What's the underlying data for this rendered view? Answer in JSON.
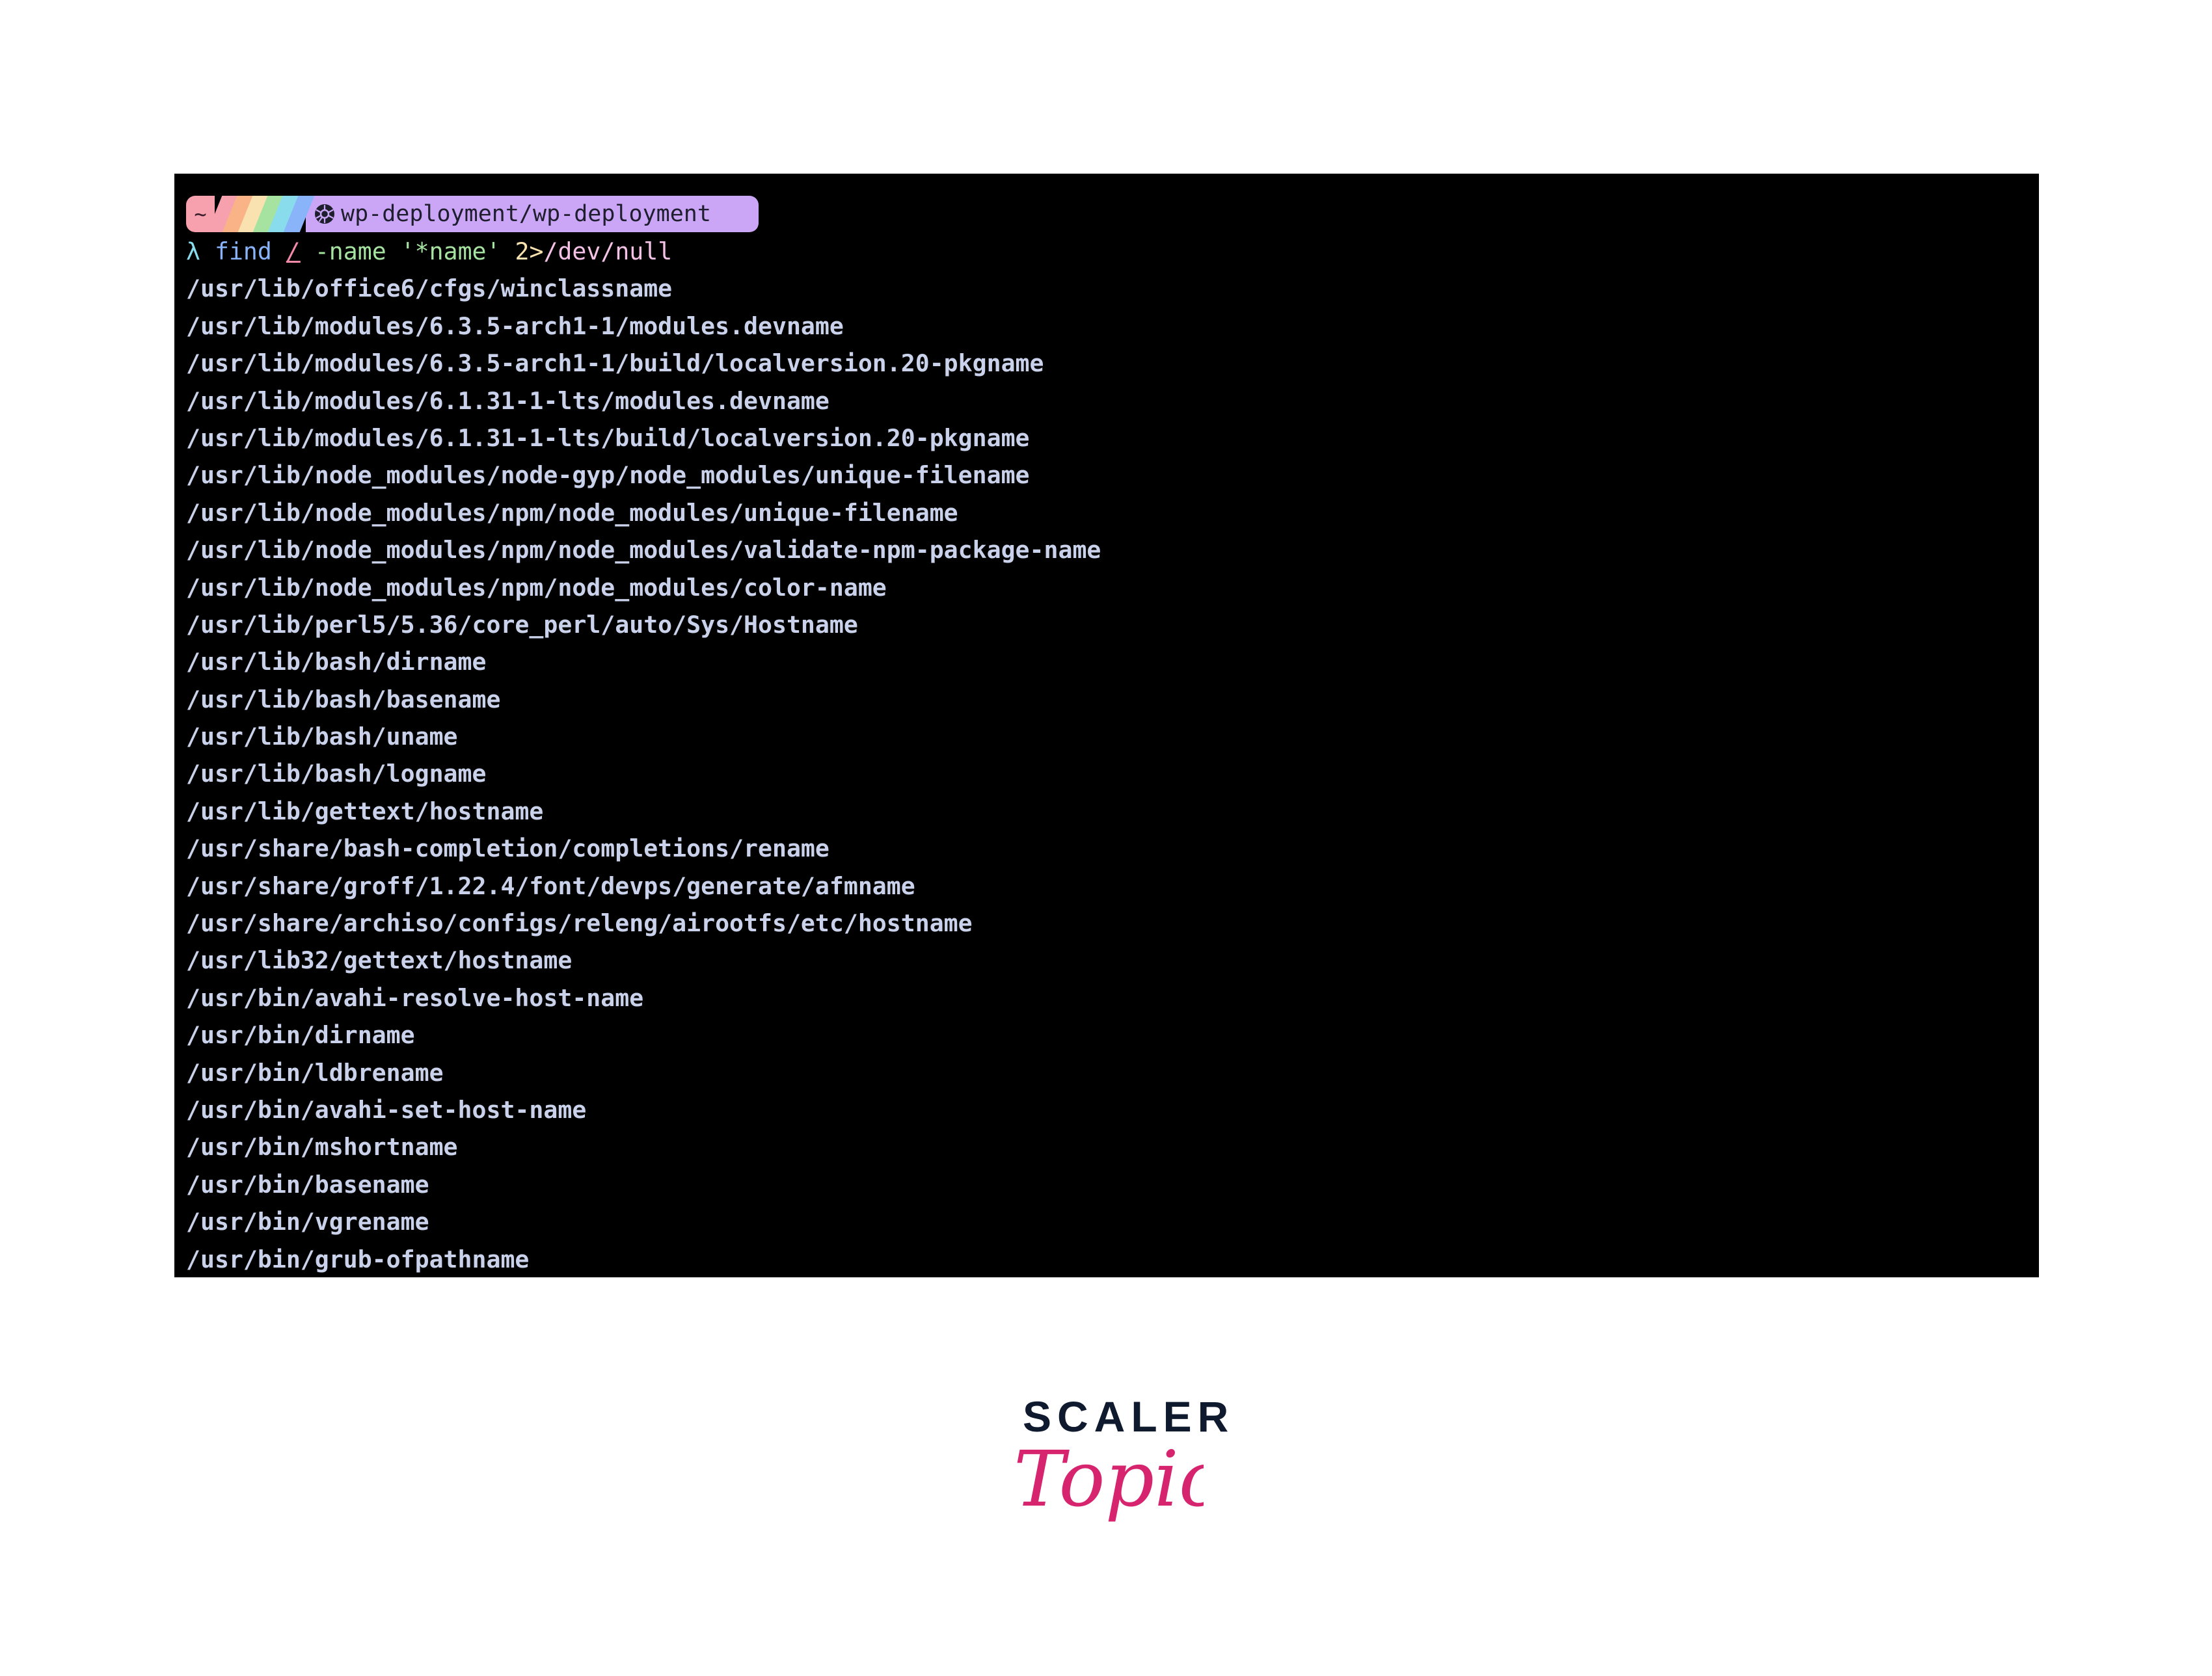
{
  "terminal": {
    "prompt": {
      "home_symbol": "~",
      "path": "wp-deployment/wp-deployment",
      "icon": "kubernetes-icon",
      "colors": {
        "home": "#f7a0ae",
        "path": "#cba6f7",
        "rainbow": [
          "#f7a0ae",
          "#fab387",
          "#f9e2af",
          "#a6e3a1",
          "#89dceb",
          "#89b4fa"
        ]
      }
    },
    "command": {
      "lambda": "λ",
      "find": "find",
      "root": "/",
      "flag": "-name",
      "pattern": "'*name'",
      "redirect": "2>",
      "target": "/dev/null"
    },
    "output": [
      "/usr/lib/office6/cfgs/winclassname",
      "/usr/lib/modules/6.3.5-arch1-1/modules.devname",
      "/usr/lib/modules/6.3.5-arch1-1/build/localversion.20-pkgname",
      "/usr/lib/modules/6.1.31-1-lts/modules.devname",
      "/usr/lib/modules/6.1.31-1-lts/build/localversion.20-pkgname",
      "/usr/lib/node_modules/node-gyp/node_modules/unique-filename",
      "/usr/lib/node_modules/npm/node_modules/unique-filename",
      "/usr/lib/node_modules/npm/node_modules/validate-npm-package-name",
      "/usr/lib/node_modules/npm/node_modules/color-name",
      "/usr/lib/perl5/5.36/core_perl/auto/Sys/Hostname",
      "/usr/lib/bash/dirname",
      "/usr/lib/bash/basename",
      "/usr/lib/bash/uname",
      "/usr/lib/bash/logname",
      "/usr/lib/gettext/hostname",
      "/usr/share/bash-completion/completions/rename",
      "/usr/share/groff/1.22.4/font/devps/generate/afmname",
      "/usr/share/archiso/configs/releng/airootfs/etc/hostname",
      "/usr/lib32/gettext/hostname",
      "/usr/bin/avahi-resolve-host-name",
      "/usr/bin/dirname",
      "/usr/bin/ldbrename",
      "/usr/bin/avahi-set-host-name",
      "/usr/bin/mshortname",
      "/usr/bin/basename",
      "/usr/bin/vgrename",
      "/usr/bin/grub-ofpathname"
    ]
  },
  "logo": {
    "top_text": "SCALER",
    "bottom_text": "Topics",
    "colors": {
      "top": "#0f1a2e",
      "bottom": "#d6246e"
    }
  }
}
